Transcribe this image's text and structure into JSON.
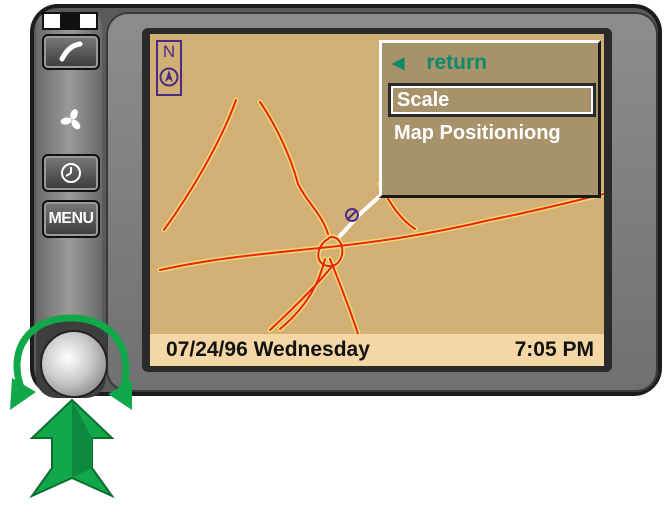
{
  "indicators": [
    {
      "name": "indicator-1",
      "filled": false
    },
    {
      "name": "indicator-2",
      "filled": true
    },
    {
      "name": "indicator-3",
      "filled": false
    }
  ],
  "controls": {
    "phone_icon": "phone-icon",
    "fan_icon": "fan-icon",
    "clock_icon": "clock-icon",
    "menu_label": "MENU"
  },
  "compass": {
    "label": "N"
  },
  "menu": {
    "return_label": "return",
    "items": [
      {
        "label": "Scale",
        "selected": true
      },
      {
        "label": "Map Positioniong",
        "selected": false
      }
    ]
  },
  "status": {
    "date": "07/24/96 Wednesday",
    "time": "7:05 PM"
  },
  "colors": {
    "map_background": "#d2b075",
    "road": "#e8251b",
    "road_edge": "#f6d96a",
    "menu_accent": "#0d8a6a",
    "arrow": "#11a84a"
  }
}
